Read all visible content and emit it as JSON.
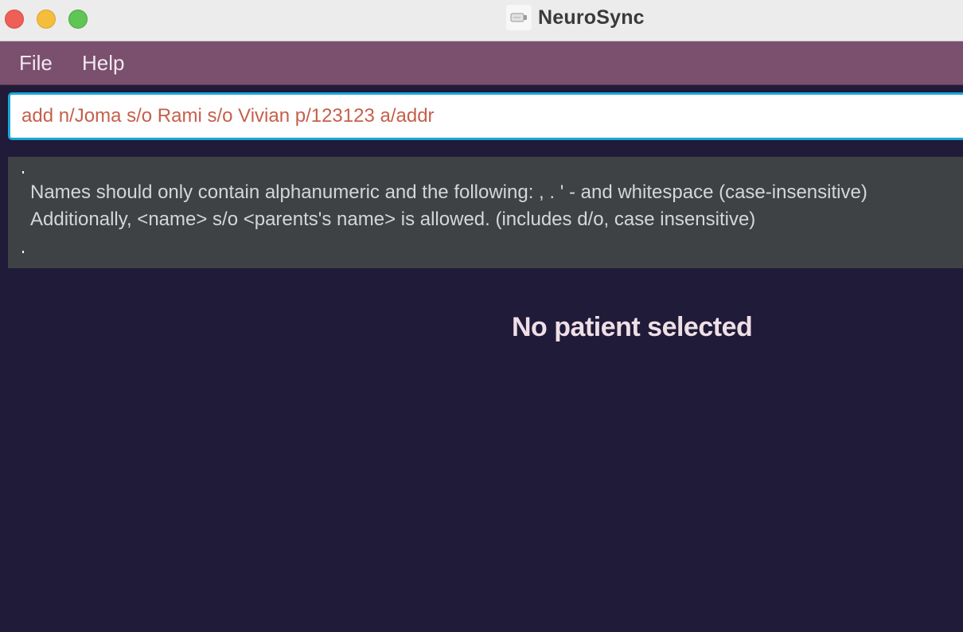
{
  "window": {
    "title": "NeuroSync",
    "controls": {
      "close_color": "#ee5f57",
      "minimize_color": "#f5bd3c",
      "zoom_color": "#5fc554"
    }
  },
  "menu": {
    "items": [
      {
        "label": "File"
      },
      {
        "label": "Help"
      }
    ]
  },
  "command": {
    "value": "add n/Joma s/o Rami s/o Vivian p/123123 a/addr",
    "text_color": "#c65f4b"
  },
  "result": {
    "lines": [
      "Names should only contain alphanumeric and the following: , . ' - and whitespace (case-insensitive)",
      "Additionally, <name> s/o <parents's name> is allowed. (includes d/o, case insensitive)"
    ]
  },
  "detail": {
    "empty_message": "No patient selected"
  },
  "colors": {
    "background": "#1f1b38",
    "menubar": "#7b4f6e",
    "focus_border": "#1aa6d9",
    "result_panel": "#3e4245"
  }
}
